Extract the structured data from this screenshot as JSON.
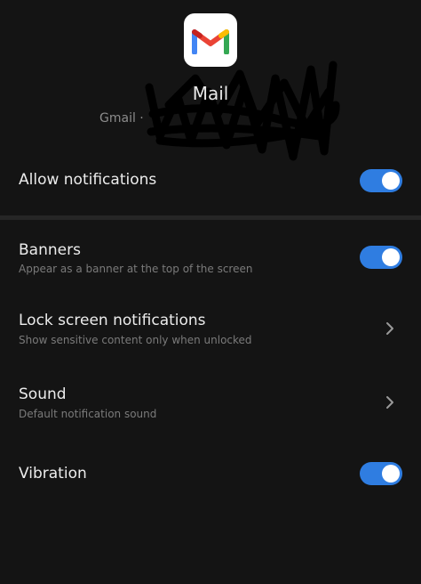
{
  "header": {
    "app_icon": "gmail-m-logo",
    "app_name": "Mail",
    "account_label": "Gmail ·"
  },
  "settings": {
    "allow_notifications": {
      "label": "Allow notifications",
      "enabled": true
    },
    "banners": {
      "label": "Banners",
      "description": "Appear as a banner at the top of the screen",
      "enabled": true
    },
    "lock_screen": {
      "label": "Lock screen notifications",
      "description": "Show sensitive content only when unlocked"
    },
    "sound": {
      "label": "Sound",
      "description": "Default notification sound"
    },
    "vibration": {
      "label": "Vibration",
      "enabled": true
    }
  },
  "colors": {
    "background": "#141414",
    "toggle_on": "#2f7de1",
    "divider": "#262626"
  }
}
